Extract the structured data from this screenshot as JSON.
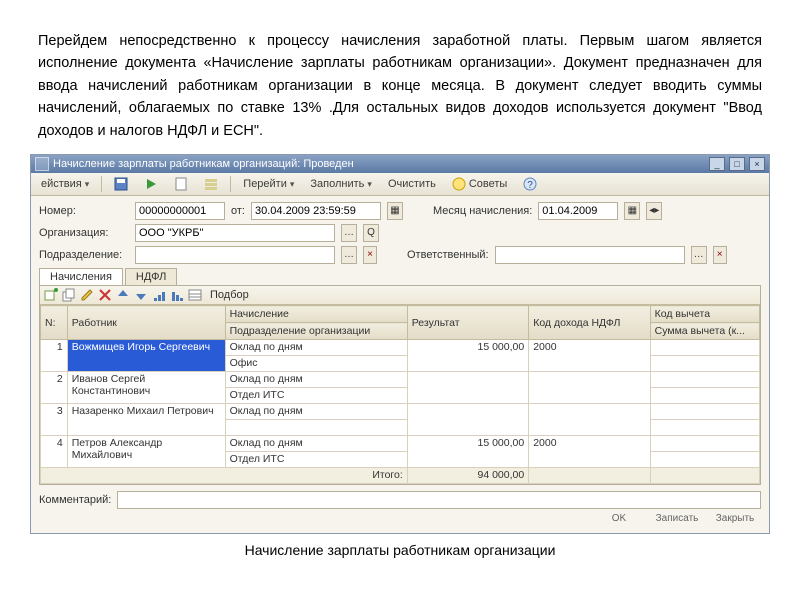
{
  "document_text": {
    "p": "Перейдем непосредственно к процессу начисления заработной платы. Первым шагом является исполнение документа «Начисление зарплаты работникам организации». Документ предназначен для ввода начислений работникам организации в конце месяца. В документ следует вводить суммы начислений, облагаемых по ставке 13% .Для остальных видов доходов используется документ \"Ввод доходов и налогов НДФЛ и ЕСН\"."
  },
  "window": {
    "title": "Начисление зарплаты работникам организаций: Проведен"
  },
  "toolbar": {
    "actions": "ействия",
    "go": "Перейти",
    "fill": "Заполнить",
    "clear": "Очистить",
    "advice": "Советы"
  },
  "form": {
    "number_label": "Номер:",
    "number": "00000000001",
    "from_label": "от:",
    "date": "30.04.2009 23:59:59",
    "month_label": "Месяц начисления:",
    "month": "01.04.2009",
    "org_label": "Организация:",
    "org": "ООО \"УКРБ\"",
    "division_label": "Подразделение:",
    "division": "",
    "responsible_label": "Ответственный:",
    "responsible": ""
  },
  "tabs": {
    "accruals": "Начисления",
    "ndfl": "НДФЛ"
  },
  "grid": {
    "selection": "Подбор",
    "headers": {
      "n": "N:",
      "employee": "Работник",
      "accrual": "Начисление",
      "division": "Подразделение организации",
      "result": "Результат",
      "ndfl_code": "Код дохода НДФЛ",
      "deduction_code": "Код вычета",
      "deduction_sum": "Сумма вычета (к..."
    },
    "rows": [
      {
        "n": "1",
        "employee": "Вожмищев Игорь Сергеевич",
        "accrual": "Оклад по дням",
        "division": "Офис",
        "result": "15 000,00",
        "ndfl_code": "2000"
      },
      {
        "n": "2",
        "employee": "Иванов Сергей Константинович",
        "accrual": "Оклад по дням",
        "division": "Отдел ИТС",
        "result": "",
        "ndfl_code": ""
      },
      {
        "n": "3",
        "employee": "Назаренко Михаил Петрович",
        "accrual": "Оклад по дням",
        "division": "",
        "result": "",
        "ndfl_code": ""
      },
      {
        "n": "4",
        "employee": "Петров Александр Михайлович",
        "accrual": "Оклад по дням",
        "division": "Отдел ИТС",
        "result": "15 000,00",
        "ndfl_code": "2000"
      }
    ],
    "total_label": "Итого:",
    "total": "94 000,00"
  },
  "comment": {
    "label": "Комментарий:",
    "value": ""
  },
  "footer": {
    "ok": "OK",
    "write": "Записать",
    "close": "Закрыть"
  },
  "caption": "Начисление зарплаты работникам организации"
}
